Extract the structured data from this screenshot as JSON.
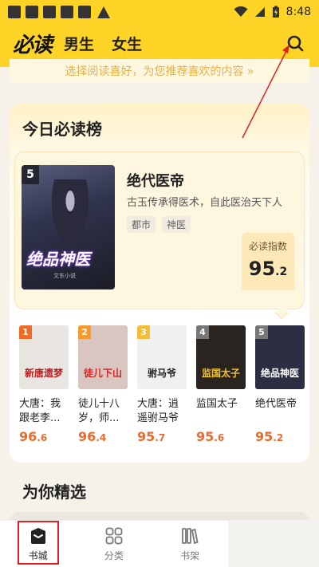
{
  "status_bar": {
    "time": "8:48"
  },
  "header": {
    "logo": "必读",
    "tabs": [
      "男生",
      "女生"
    ]
  },
  "preference_banner": {
    "text": "选择阅读喜好，为您推荐喜欢的内容 »"
  },
  "ranking": {
    "title": "今日必读榜",
    "featured": {
      "rank": "5",
      "cover_title": "绝品神医",
      "cover_author": "文东小说",
      "name": "绝代医帝",
      "description": "古玉传承得医术，自此医治天下人",
      "tags": [
        "都市",
        "神医"
      ],
      "score_label": "必读指数",
      "score_int": "95",
      "score_dec": ".2"
    },
    "books": [
      {
        "rank": "1",
        "cover_text": "新唐遗梦",
        "name": "大唐：我跟老李...",
        "score_int": "96",
        "score_dec": ".6",
        "rank_color": "#f26b25",
        "cover_bg": "#e9e6e2",
        "cover_fg": "#b82020"
      },
      {
        "rank": "2",
        "cover_text": "徒儿下山",
        "name": "徒儿十八岁，师...",
        "score_int": "96",
        "score_dec": ".4",
        "rank_color": "#f59a2e",
        "cover_bg": "#d9c6c0",
        "cover_fg": "#d42222"
      },
      {
        "rank": "3",
        "cover_text": "驸马爷",
        "name": "大唐：逍遥驸马爷",
        "score_int": "95",
        "score_dec": ".7",
        "rank_color": "#f3bd3a",
        "cover_bg": "#eef0f2",
        "cover_fg": "#222222"
      },
      {
        "rank": "4",
        "cover_text": "监国太子",
        "name": "监国太子",
        "score_int": "95",
        "score_dec": ".6",
        "rank_color": "#777777",
        "cover_bg": "#2a2420",
        "cover_fg": "#f2c230"
      },
      {
        "rank": "5",
        "cover_text": "绝品神医",
        "name": "绝代医帝",
        "score_int": "95",
        "score_dec": ".2",
        "rank_color": "#777777",
        "cover_bg": "#2c2f44",
        "cover_fg": "#ffffff"
      }
    ]
  },
  "recommend": {
    "title": "为你精选"
  },
  "bottom_nav": {
    "items": [
      {
        "label": "书城",
        "icon": "bookstore-icon",
        "active": true
      },
      {
        "label": "分类",
        "icon": "grid-icon",
        "active": false
      },
      {
        "label": "书架",
        "icon": "bookshelf-icon",
        "active": false
      }
    ]
  },
  "colors": {
    "brand_yellow": "#ffd426",
    "score_orange": "#ee6a2a",
    "annotation_red": "#e0211f"
  }
}
